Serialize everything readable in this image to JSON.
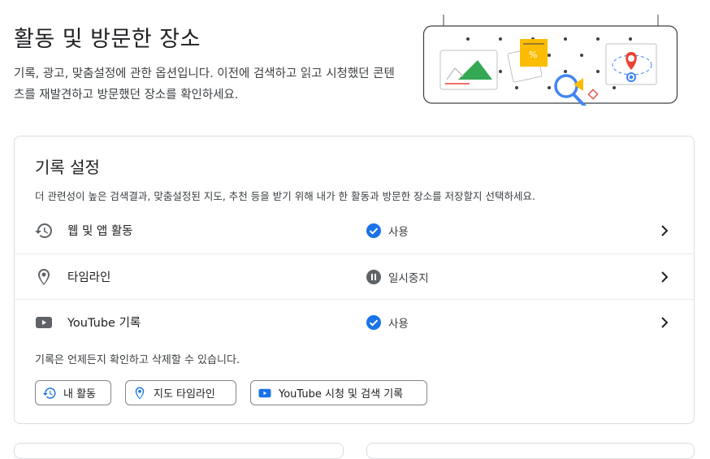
{
  "header": {
    "title": "활동 및 방문한 장소",
    "description": "기록, 광고, 맞춤설정에 관한 옵션입니다. 이전에 검색하고 읽고 시청했던 콘텐츠를 재발견하고 방문했던 장소를 확인하세요."
  },
  "history": {
    "title": "기록 설정",
    "subtitle": "더 관련성이 높은 검색결과, 맞춤설정된 지도, 추천 등을 받기 위해 내가 한 활동과 방문한 장소를 저장할지 선택하세요.",
    "rows": [
      {
        "label": "웹 및 앱 활동",
        "status": "사용",
        "icon": "history-icon",
        "status_icon": "check-circle-icon"
      },
      {
        "label": "타임라인",
        "status": "일시중지",
        "icon": "location-pin-icon",
        "status_icon": "pause-circle-icon"
      },
      {
        "label": "YouTube 기록",
        "status": "사용",
        "icon": "youtube-icon",
        "status_icon": "check-circle-icon"
      }
    ],
    "footnote": "기록은 언제든지 확인하고 삭제할 수 있습니다.",
    "chips": [
      {
        "label": "내 활동",
        "icon": "history-icon"
      },
      {
        "label": "지도 타임라인",
        "icon": "location-pin-icon"
      },
      {
        "label": "YouTube 시청 및 검색 기록",
        "icon": "youtube-icon"
      }
    ]
  },
  "colors": {
    "accent_blue": "#1a73e8",
    "paused_gray": "#5f6368",
    "text_primary": "#202124",
    "border": "#dadce0"
  }
}
